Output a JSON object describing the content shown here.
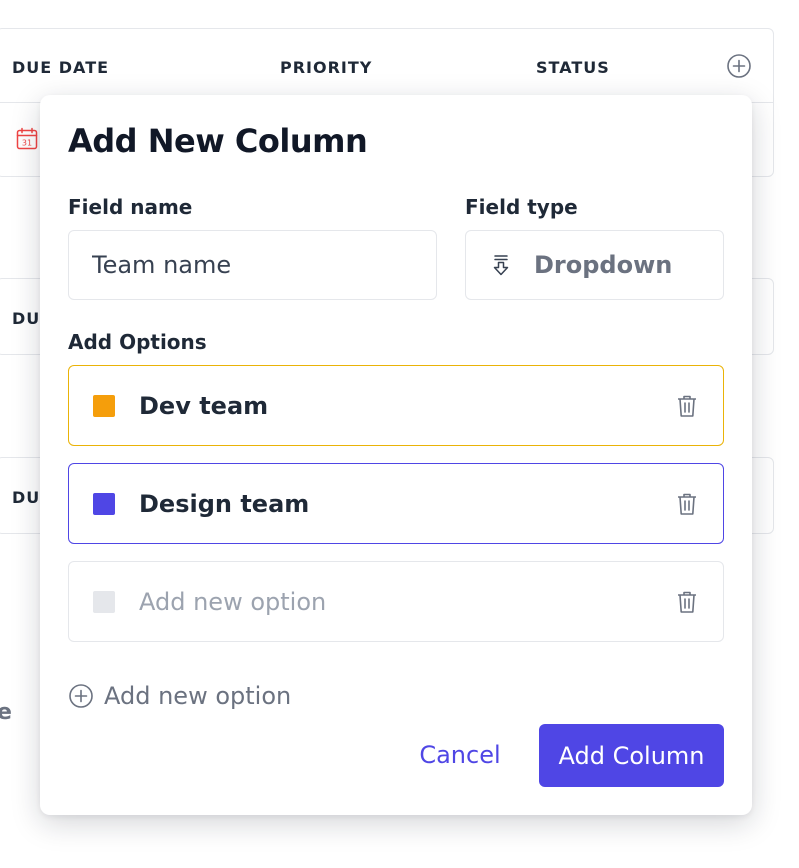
{
  "table": {
    "headers": {
      "due_date": "DUE DATE",
      "priority": "PRIORITY",
      "status": "STATUS"
    },
    "partial_row_2": "DU",
    "partial_row_3": "DU",
    "edge_char": "e"
  },
  "modal": {
    "title": "Add New Column",
    "field_name_label": "Field name",
    "field_name_value": "Team name",
    "field_type_label": "Field type",
    "field_type_value": "Dropdown",
    "options_label": "Add Options",
    "options": [
      {
        "label": "Dev team",
        "color": "#F59E0B"
      },
      {
        "label": "Design team",
        "color": "#4F46E5"
      },
      {
        "placeholder": "Add new option",
        "color": "#E5E7EB"
      }
    ],
    "add_option_label": "Add new option",
    "cancel_label": "Cancel",
    "submit_label": "Add Column"
  },
  "icons": {
    "add_column": "plus-circle-icon",
    "calendar": "calendar-icon",
    "dropdown_type": "dropdown-arrow-icon",
    "delete": "trash-icon",
    "add_option": "plus-circle-icon"
  },
  "colors": {
    "accent": "#4F46E5",
    "option_dev_border": "#EAB308",
    "calendar_red": "#EF4444"
  }
}
